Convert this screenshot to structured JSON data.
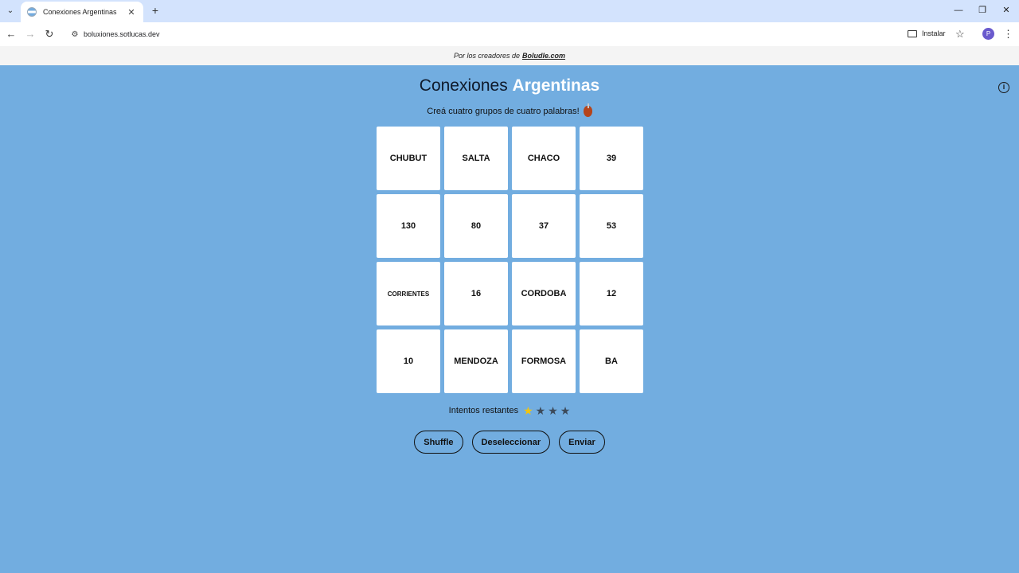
{
  "browser": {
    "tab_title": "Conexiones Argentinas",
    "url": "boluxiones.sotlucas.dev",
    "install_label": "Instalar",
    "profile_initial": "P"
  },
  "credits": {
    "prefix": "Por los creadores de",
    "brand": "Boludle.com"
  },
  "game": {
    "title_main": "Conexiones",
    "title_accent": "Argentinas",
    "subtitle": "Creá cuatro grupos de cuatro palabras!",
    "tiles": [
      "CHUBUT",
      "SALTA",
      "CHACO",
      "39",
      "130",
      "80",
      "37",
      "53",
      "CORRIENTES",
      "16",
      "CORDOBA",
      "12",
      "10",
      "MENDOZA",
      "FORMOSA",
      "BA"
    ],
    "attempts_label": "Intentos restantes",
    "attempts_total": 4,
    "attempts_highlighted": 1,
    "buttons": {
      "shuffle": "Shuffle",
      "deselect": "Deseleccionar",
      "submit": "Enviar"
    }
  },
  "colors": {
    "page_bg": "#72ade0",
    "star_active": "#f1c40f",
    "star_inactive": "#3c4a5a"
  }
}
